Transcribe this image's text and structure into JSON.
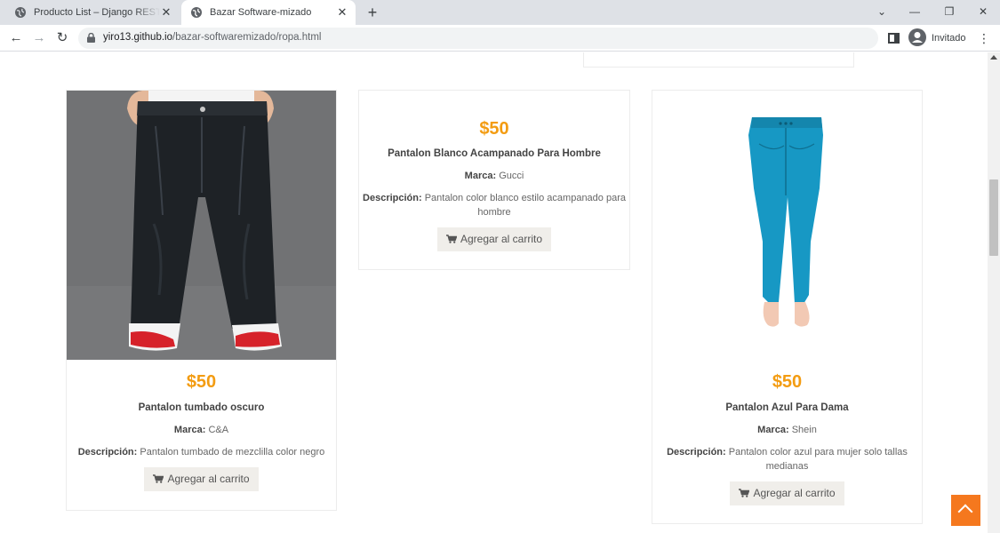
{
  "browser": {
    "tabs": [
      {
        "title": "Producto List – Django REST fram"
      },
      {
        "title": "Bazar Software-mizado"
      }
    ],
    "url_host": "yiro13.github.io",
    "url_path": "/bazar-softwaremizado/ropa.html",
    "profile_label": "Invitado"
  },
  "products": [
    {
      "price": "$50",
      "name": "Pantalon tumbado oscuro",
      "brand_label": "Marca:",
      "brand": "C&A",
      "desc_label": "Descripción:",
      "description": "Pantalon tumbado de mezclilla color negro",
      "button_label": "Agregar al carrito"
    },
    {
      "price": "$50",
      "name": "Pantalon Blanco Acampanado Para Hombre",
      "brand_label": "Marca:",
      "brand": "Gucci",
      "desc_label": "Descripción:",
      "description": "Pantalon color blanco estilo acampanado para hombre",
      "button_label": "Agregar al carrito"
    },
    {
      "price": "$50",
      "name": "Pantalon Azul Para Dama",
      "brand_label": "Marca:",
      "brand": "Shein",
      "desc_label": "Descripción:",
      "description": "Pantalon color azul para mujer solo tallas medianas",
      "button_label": "Agregar al carrito"
    }
  ],
  "colors": {
    "price": "#f39c12",
    "scroll_top_button": "#f5781e"
  },
  "icons": [
    "globe-icon",
    "close-icon",
    "plus-icon",
    "back-arrow-icon",
    "forward-arrow-icon",
    "reload-icon",
    "lock-icon",
    "side-panel-icon",
    "profile-icon",
    "menu-dots-icon",
    "cart-icon",
    "chevron-up-icon"
  ]
}
